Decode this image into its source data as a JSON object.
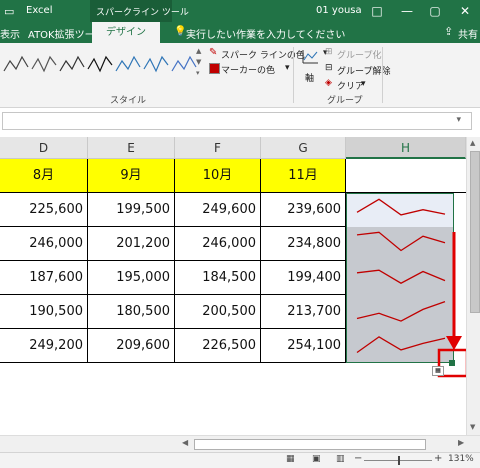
{
  "window": {
    "app_title": "Excel",
    "context_tool": "スパークライン ツール",
    "user": "01 yousa",
    "controls": [
      "□",
      "—",
      "▢",
      "✕"
    ]
  },
  "tabs": {
    "view_partial": "表示",
    "atok": "ATOK拡張ツール",
    "design": "デザイン",
    "tell_me": "実行したい作業を入力してください",
    "share": "共有"
  },
  "ribbon": {
    "sparkline_color": "スパーク ラインの色",
    "marker_color": "マーカーの色",
    "style_group": "スタイル",
    "axis": "軸",
    "group_btn": "グループ化",
    "ungroup_btn": "グループ解除",
    "clear_btn": "クリア",
    "group_group": "グループ",
    "style_colors": [
      "#444444",
      "#555555",
      "#333333",
      "#111111",
      "#2e75b6",
      "#2e75b6",
      "#4472c4"
    ]
  },
  "columns": [
    "D",
    "E",
    "F",
    "G",
    "H"
  ],
  "header_row": [
    "8月",
    "9月",
    "10月",
    "11月",
    ""
  ],
  "rows": [
    [
      "225,600",
      "199,500",
      "249,600",
      "239,600"
    ],
    [
      "246,000",
      "201,200",
      "246,000",
      "234,800"
    ],
    [
      "187,600",
      "195,000",
      "184,500",
      "199,400"
    ],
    [
      "190,500",
      "180,500",
      "200,500",
      "213,700"
    ],
    [
      "249,200",
      "209,600",
      "226,500",
      "254,100"
    ]
  ],
  "sparklines": [
    [
      0.55,
      0.05,
      0.65,
      0.45,
      0.62
    ],
    [
      0.15,
      0.05,
      0.75,
      0.2,
      0.45
    ],
    [
      0.3,
      0.2,
      0.7,
      0.25,
      0.6
    ],
    [
      0.75,
      0.55,
      0.85,
      0.4,
      0.1
    ],
    [
      0.75,
      0.15,
      0.65,
      0.4,
      0.2
    ]
  ],
  "colors": {
    "excel_green": "#217346",
    "header_yellow": "#ffff00",
    "spark_red": "#c00000",
    "callout_red": "#e00000"
  },
  "status": {
    "zoom": "131%"
  }
}
